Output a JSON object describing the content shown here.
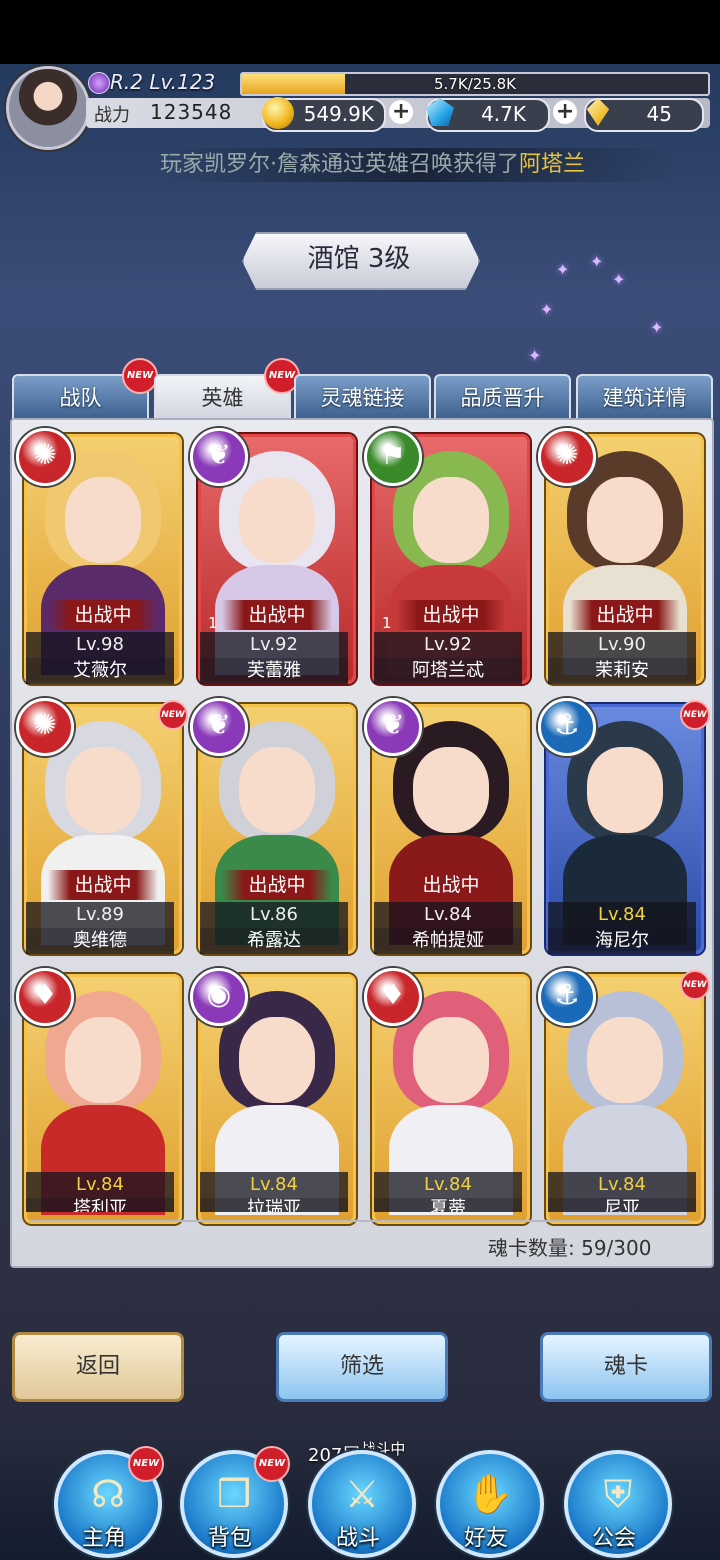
{
  "header": {
    "rank_level": "R.2 Lv.123",
    "exp_text": "5.7K/25.8K",
    "exp_fraction": 0.22,
    "power_label": "战力",
    "power_value": "123548",
    "gold": "549.9K",
    "gems": "4.7K",
    "crystals": "45"
  },
  "marquee": {
    "prefix": "玩家",
    "player": "凯罗尔·詹森",
    "middle": "通过英雄召唤获得了",
    "hero": "阿塔兰"
  },
  "title": "酒馆 3级",
  "tabs": [
    {
      "label": "战队",
      "new": true,
      "active": false
    },
    {
      "label": "英雄",
      "new": true,
      "active": true
    },
    {
      "label": "灵魂链接",
      "new": false,
      "active": false
    },
    {
      "label": "品质晋升",
      "new": false,
      "active": false
    },
    {
      "label": "建筑详情",
      "new": false,
      "active": false
    }
  ],
  "new_badge": "NEW",
  "cards": [
    {
      "name": "艾薇尔",
      "level": "Lv.98",
      "status": "出战中",
      "element": "wind",
      "frame": "gold",
      "new": false,
      "stars": ""
    },
    {
      "name": "芙蕾雅",
      "level": "Lv.92",
      "status": "出战中",
      "element": "light",
      "frame": "red",
      "new": false,
      "stars": "1"
    },
    {
      "name": "阿塔兰忒",
      "level": "Lv.92",
      "status": "出战中",
      "element": "nature",
      "frame": "red",
      "new": false,
      "stars": "1"
    },
    {
      "name": "茉莉安",
      "level": "Lv.90",
      "status": "出战中",
      "element": "wind",
      "frame": "gold",
      "new": false,
      "stars": ""
    },
    {
      "name": "奥维德",
      "level": "Lv.89",
      "status": "出战中",
      "element": "wind",
      "frame": "gold",
      "new": true,
      "stars": ""
    },
    {
      "name": "希露达",
      "level": "Lv.86",
      "status": "出战中",
      "element": "light",
      "frame": "gold",
      "new": false,
      "stars": ""
    },
    {
      "name": "希帕提娅",
      "level": "Lv.84",
      "status": "出战中",
      "element": "light",
      "frame": "gold",
      "new": false,
      "stars": ""
    },
    {
      "name": "海尼尔",
      "level": "Lv.84",
      "status": "",
      "element": "water",
      "frame": "blue",
      "new": true,
      "stars": ""
    },
    {
      "name": "塔利亚",
      "level": "Lv.84",
      "status": "",
      "element": "fire",
      "frame": "gold",
      "new": false,
      "stars": ""
    },
    {
      "name": "拉瑞亚",
      "level": "Lv.84",
      "status": "",
      "element": "dark",
      "frame": "gold",
      "new": false,
      "stars": ""
    },
    {
      "name": "夏蒂",
      "level": "Lv.84",
      "status": "",
      "element": "fire",
      "frame": "gold",
      "new": false,
      "stars": ""
    },
    {
      "name": "尼亚",
      "level": "Lv.84",
      "status": "",
      "element": "water",
      "frame": "gold",
      "new": true,
      "stars": ""
    }
  ],
  "card_count": "魂卡数量: 59/300",
  "buttons": {
    "back": "返回",
    "filter": "筛选",
    "soulcard": "魂卡"
  },
  "battle": {
    "floor": "207层",
    "status": "战斗中"
  },
  "nav": [
    {
      "label": "主角",
      "icon": "helmet-icon",
      "new": true
    },
    {
      "label": "背包",
      "icon": "backpack-icon",
      "new": true
    },
    {
      "label": "战斗",
      "icon": "swords-icon",
      "new": false
    },
    {
      "label": "好友",
      "icon": "handshake-icon",
      "new": false
    },
    {
      "label": "公会",
      "icon": "guild-icon",
      "new": false
    }
  ],
  "colors": {
    "accent_gold": "#e8c23a",
    "frame_gold": "#f4c24a",
    "frame_red": "#e04848",
    "frame_blue": "#4a6ad8",
    "badge_red": "#d01f2a"
  }
}
